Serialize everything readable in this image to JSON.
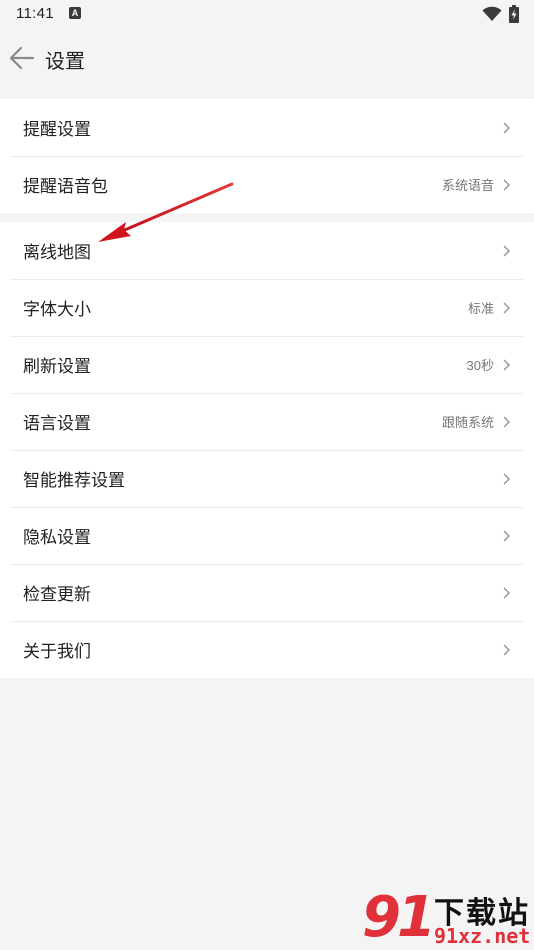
{
  "status_bar": {
    "time": "11:41",
    "notification_icon": "a-badge-icon",
    "wifi_icon": "wifi-icon",
    "battery_icon": "battery-charging-icon"
  },
  "header": {
    "back_icon": "arrow-left-icon",
    "title": "设置"
  },
  "groups": [
    {
      "items": [
        {
          "label": "提醒设置",
          "value": ""
        },
        {
          "label": "提醒语音包",
          "value": "系统语音"
        }
      ]
    },
    {
      "items": [
        {
          "label": "离线地图",
          "value": ""
        },
        {
          "label": "字体大小",
          "value": "标准"
        },
        {
          "label": "刷新设置",
          "value": "30秒"
        },
        {
          "label": "语言设置",
          "value": "跟随系统"
        },
        {
          "label": "智能推荐设置",
          "value": ""
        },
        {
          "label": "隐私设置",
          "value": ""
        },
        {
          "label": "检查更新",
          "value": ""
        },
        {
          "label": "关于我们",
          "value": ""
        }
      ]
    }
  ],
  "annotation": {
    "arrow_color": "#d0141e"
  },
  "watermark": {
    "logo": "91",
    "title": "下载站",
    "url": "91xz.net"
  },
  "colors": {
    "background": "#f4f4f4",
    "card": "#ffffff",
    "divider": "#ececec",
    "text_primary": "#222222",
    "text_secondary": "#777777",
    "chevron": "#999999"
  }
}
